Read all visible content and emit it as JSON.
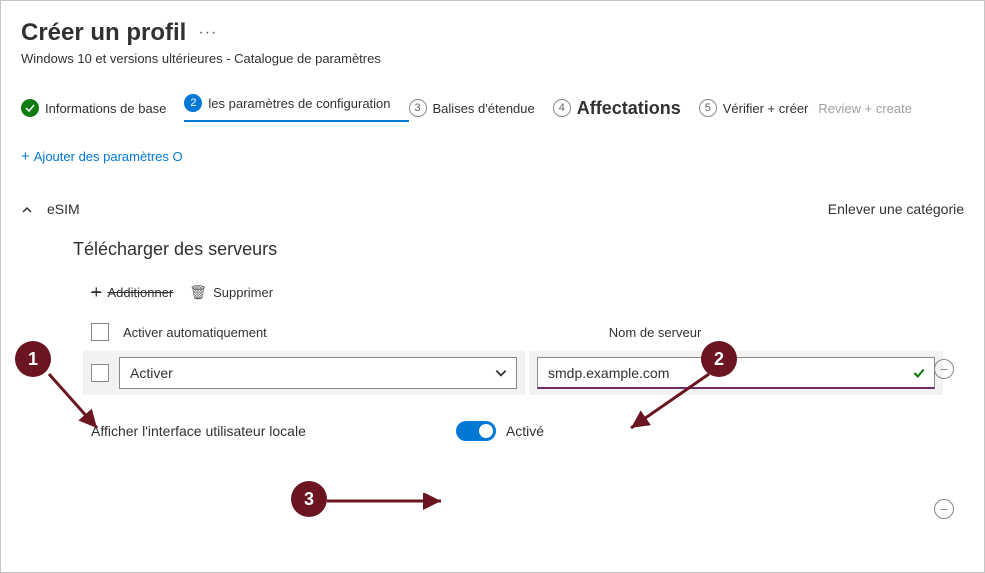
{
  "header": {
    "title": "Créer un profil",
    "subtitle": "Windows 10 et versions ultérieures - Catalogue de paramètres"
  },
  "steps": [
    {
      "num": "",
      "label": "Informations de base"
    },
    {
      "num": "2",
      "label": "les paramètres de configuration"
    },
    {
      "num": "3",
      "label": "Balises d'étendue"
    },
    {
      "num": "4",
      "label": "Affectations"
    },
    {
      "num": "5",
      "label": "Vérifier + créer"
    },
    {
      "num": "",
      "label": "Review + create"
    }
  ],
  "links": {
    "add_settings": "Ajouter des paramètres O"
  },
  "category": {
    "name": "eSIM",
    "remove_label": "Enlever une catégorie"
  },
  "section": {
    "title": "Télécharger des serveurs",
    "auto_enable_header": "Activer automatiquement",
    "server_name_header": "Nom de serveur",
    "show_ui_label": "Afficher l'interface utilisateur locale",
    "show_ui_state": "Activé"
  },
  "commands": {
    "add": "Additionner",
    "delete": "Supprimer"
  },
  "row": {
    "enable_value": "Activer",
    "server_value": "smdp.example.com"
  },
  "annotations": [
    "1",
    "2",
    "3"
  ],
  "colors": {
    "primary": "#0078d4",
    "success": "#107c10",
    "badge": "#6b1520"
  }
}
